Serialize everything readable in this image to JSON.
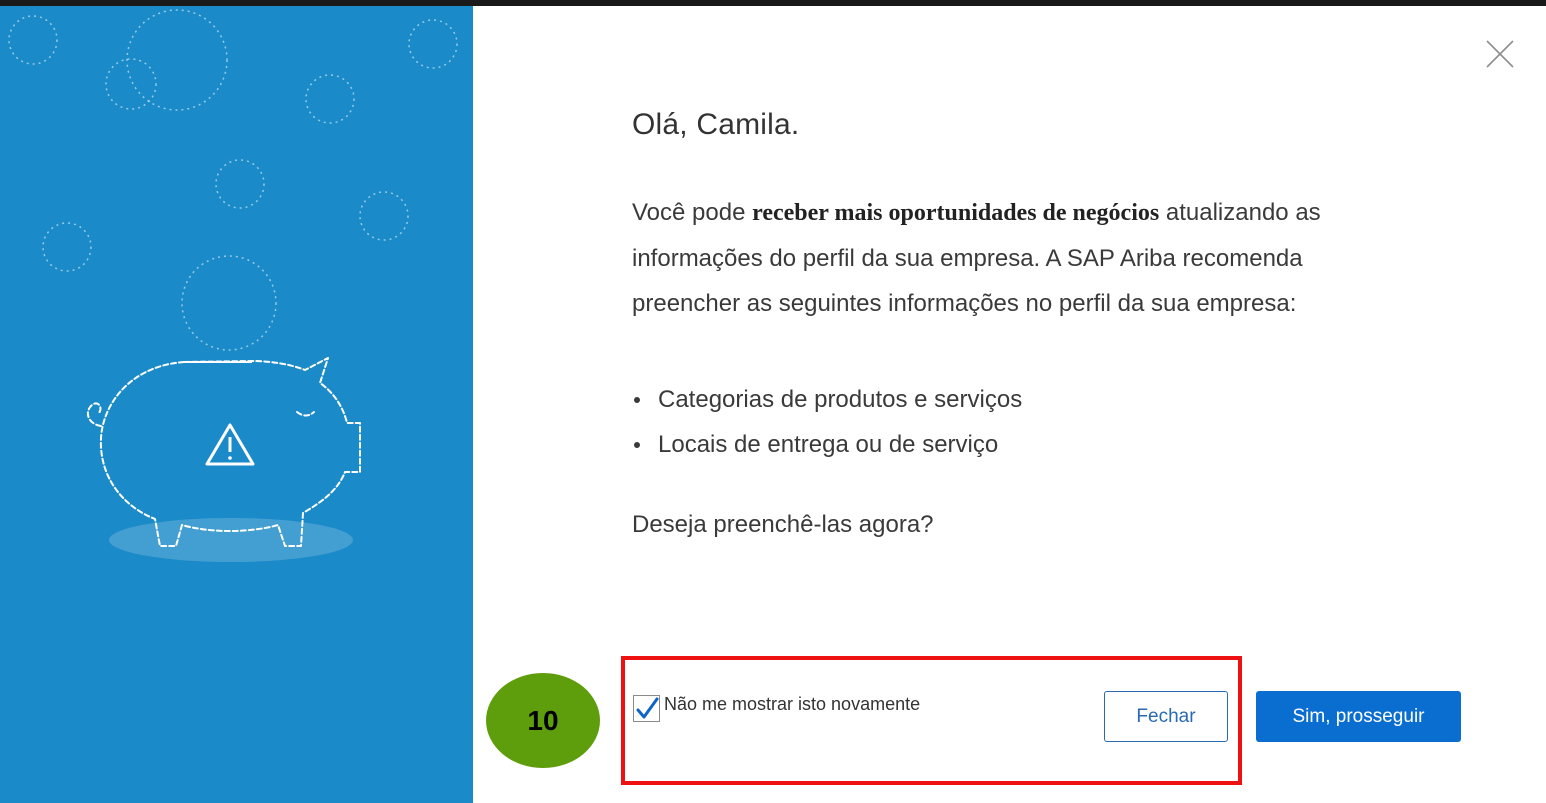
{
  "dialog": {
    "greeting": "Olá, Camila.",
    "body_prefix": "Você pode ",
    "body_bold": "receber mais oportunidades de negócios",
    "body_rest": " atualizando as informações do perfil da sua empresa. A SAP Ariba recomenda preencher as seguintes informações no perfil da sua empresa:",
    "bullets": [
      "Categorias de produtos e serviços",
      "Locais de entrega ou de serviço"
    ],
    "question": "Deseja preenchê-las agora?",
    "checkbox_label": "Não me mostrar isto novamente",
    "checkbox_checked": true,
    "close_button": "Fechar",
    "confirm_button": "Sim, prosseguir"
  },
  "annotation": {
    "step_number": "10",
    "badge_color": "#5e9d0b",
    "highlight_color": "#ee1111"
  },
  "colors": {
    "left_panel": "#1a8ac8",
    "primary_button": "#0a6ed1",
    "secondary_button_border": "#2a6ab0"
  },
  "icons": {
    "close": "close-icon",
    "illustration": "piggy-bank-warning-illustration",
    "checkmark": "checkmark-icon"
  }
}
